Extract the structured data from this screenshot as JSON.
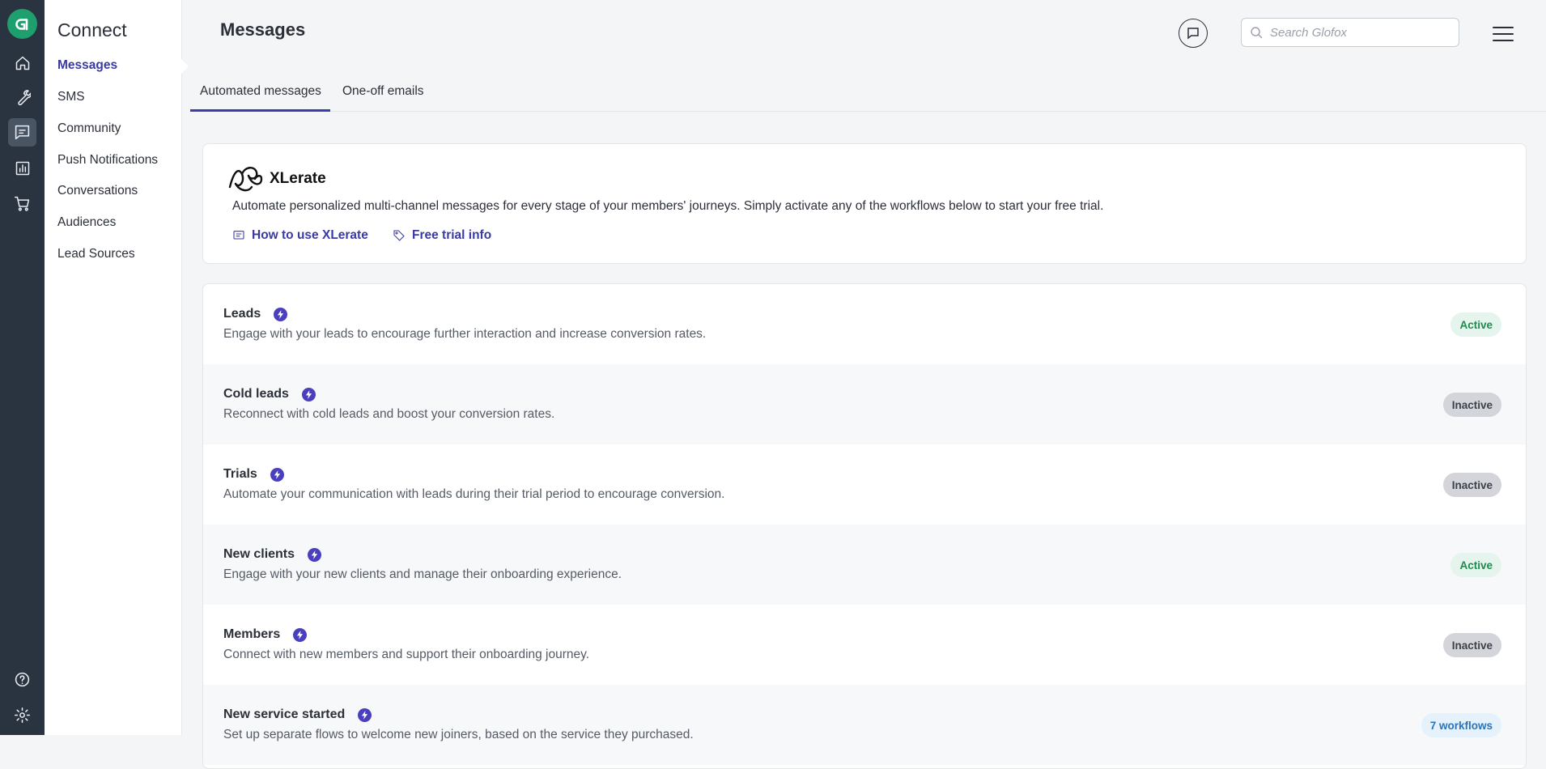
{
  "sidebar": {
    "title": "Connect",
    "items": [
      {
        "label": "Messages"
      },
      {
        "label": "SMS"
      },
      {
        "label": "Community"
      },
      {
        "label": "Push Notifications"
      },
      {
        "label": "Conversations"
      },
      {
        "label": "Audiences"
      },
      {
        "label": "Lead Sources"
      }
    ]
  },
  "rail": {
    "icons": [
      "glofox-logo",
      "home-icon",
      "wrench-icon",
      "messages-icon",
      "reports-icon",
      "cart-icon",
      "help-icon",
      "settings-icon"
    ]
  },
  "header": {
    "title": "Messages",
    "search_placeholder": "Search Glofox"
  },
  "tabs": [
    {
      "label": "Automated messages"
    },
    {
      "label": "One-off emails"
    }
  ],
  "xlerate": {
    "brand": "XLerate",
    "description": "Automate personalized multi-channel messages for every stage of your members' journeys. Simply activate any of the workflows below to start your free trial.",
    "how_to_label": "How to use XLerate",
    "trial_label": "Free trial info"
  },
  "workflows": [
    {
      "name": "Leads",
      "description": "Engage with your leads to encourage further interaction and increase conversion rates.",
      "status": "Active"
    },
    {
      "name": "Cold leads",
      "description": "Reconnect with cold leads and boost your conversion rates.",
      "status": "Inactive"
    },
    {
      "name": "Trials",
      "description": "Automate your communication with leads during their trial period to encourage conversion.",
      "status": "Inactive"
    },
    {
      "name": "New clients",
      "description": "Engage with your new clients and manage their onboarding experience.",
      "status": "Active"
    },
    {
      "name": "Members",
      "description": "Connect with new members and support their onboarding journey.",
      "status": "Inactive"
    },
    {
      "name": "New service started",
      "description": "Set up separate flows to welcome new joiners, based on the service they purchased.",
      "status": "7 workflows"
    }
  ],
  "colors": {
    "accent": "#3a3aa3",
    "rail": "#2a3441",
    "active_badge": "#1e8a4c",
    "logo": "#1f9e6e"
  }
}
